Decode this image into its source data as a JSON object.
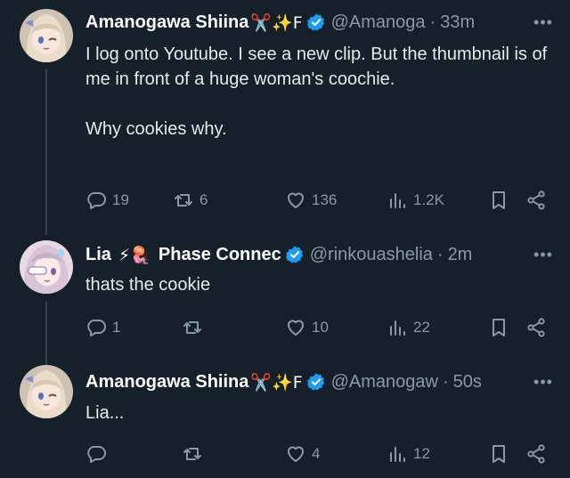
{
  "colors": {
    "background": "#15202b",
    "text": "#e7e9ea",
    "muted": "#8b98a5",
    "verified": "#1d9bf0",
    "thread_line": "#38444d"
  },
  "tweets": [
    {
      "name": "Amanogawa Shiina",
      "emoji": "✂️✨F",
      "handle": "@Amanoga",
      "time": "33m",
      "text": "I log onto Youtube. I see a new clip. But the thumbnail is of me in front of a huge woman's coochie.\n\nWhy cookies why.",
      "replies": "19",
      "retweets": "6",
      "likes": "136",
      "views": "1.2K"
    },
    {
      "name": "Lia",
      "emoji": "⚡🪼",
      "name_suffix": "Phase Connec",
      "handle": "@rinkouashelia",
      "time": "2m",
      "text": "thats the cookie",
      "replies": "1",
      "retweets": "",
      "likes": "10",
      "views": "22"
    },
    {
      "name": "Amanogawa Shiina",
      "emoji": "✂️✨F",
      "handle": "@Amanogaw",
      "time": "50s",
      "text": "Lia...",
      "replies": "",
      "retweets": "",
      "likes": "4",
      "views": "12"
    }
  ],
  "icons": [
    "reply-icon",
    "retweet-icon",
    "like-icon",
    "views-icon",
    "bookmark-icon",
    "share-icon",
    "more-icon",
    "verified-icon"
  ]
}
